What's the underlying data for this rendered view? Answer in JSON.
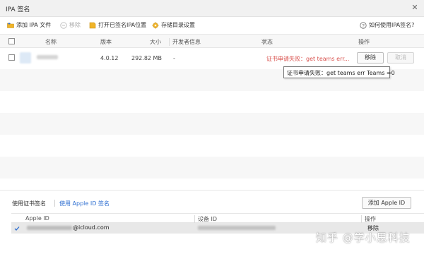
{
  "window": {
    "title": "IPA 签名"
  },
  "toolbar": {
    "add_ipa": "添加 IPA 文件",
    "remove": "移除",
    "open_location": "打开已签名IPA位置",
    "storage_settings": "存储目录设置",
    "help": "如何使用IPA签名?"
  },
  "table": {
    "headers": {
      "name": "名称",
      "version": "版本",
      "size": "大小",
      "developer": "开发者信息",
      "status": "状态",
      "action": "操作"
    },
    "rows": [
      {
        "version": "4.0.12",
        "size": "292.82 MB",
        "developer": "-",
        "status": "证书申请失败：get teams err...",
        "remove_label": "移除",
        "cancel_label": "取消"
      }
    ]
  },
  "tooltip": {
    "text": "证书申请失败：get teams err Teams =0"
  },
  "bottom": {
    "tab_cert": "使用证书签名",
    "tab_appleid": "使用 Apple ID 签名",
    "add_appleid": "添加 Apple ID"
  },
  "accounts": {
    "headers": {
      "apple_id": "Apple ID",
      "device_id": "设备 ID",
      "action": "操作"
    },
    "rows": [
      {
        "email_suffix": "@icloud.com",
        "action": "移除"
      }
    ]
  },
  "watermark": "知乎 @学小思科技",
  "colors": {
    "status_error": "#d9534f",
    "link": "#2f6fd1",
    "check": "#2f6fd1",
    "icon_folder": "#f0b429"
  }
}
